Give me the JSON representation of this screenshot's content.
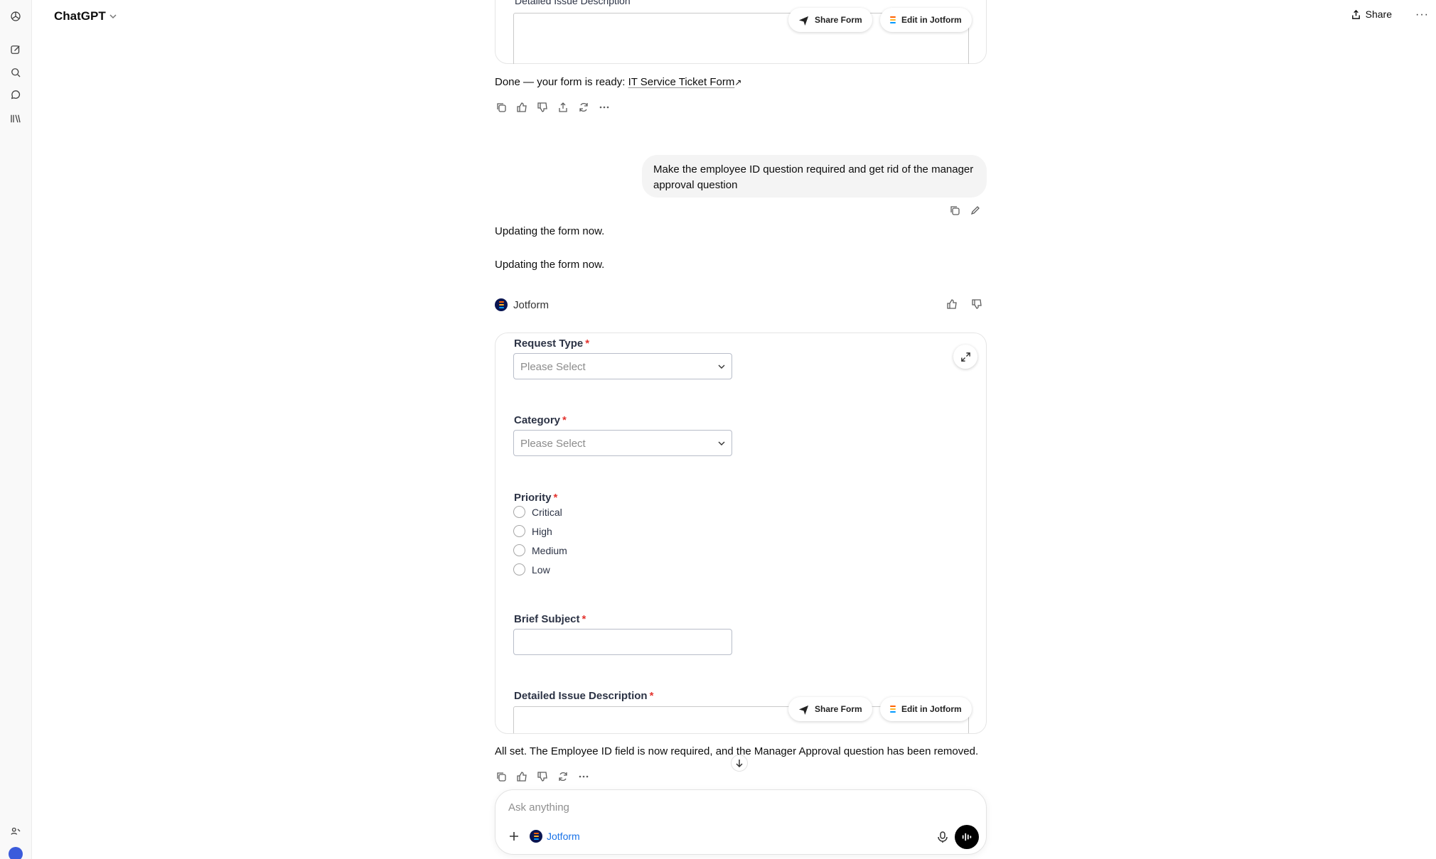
{
  "app": {
    "model_name": "ChatGPT"
  },
  "header": {
    "share_label": "Share",
    "more_label": "···"
  },
  "previous_form": {
    "partial_label": "Detailed Issue Description",
    "share_form_label": "Share Form",
    "edit_label": "Edit in Jotform"
  },
  "assistant_1": {
    "prefix": "Done — your form is ready: ",
    "link_text": "IT Service Ticket Form",
    "link_arrow": "↗"
  },
  "user_message": "Make the employee ID question required  and get rid of the manager approval question",
  "assistant_2": {
    "line1": "Updating the form now.",
    "line2": "Updating the form now."
  },
  "tool": {
    "name": "Jotform"
  },
  "form": {
    "fields": {
      "request_type": {
        "label": "Request Type",
        "placeholder": "Please Select"
      },
      "category": {
        "label": "Category",
        "placeholder": "Please Select"
      },
      "priority": {
        "label": "Priority",
        "options": [
          "Critical",
          "High",
          "Medium",
          "Low"
        ]
      },
      "brief_subject": {
        "label": "Brief Subject"
      },
      "description": {
        "label": "Detailed Issue Description"
      }
    },
    "required_marker": "*",
    "share_form_label": "Share Form",
    "edit_label": "Edit in Jotform"
  },
  "assistant_3": "All set. The Employee ID field is now required, and the Manager Approval question has been removed.",
  "composer": {
    "placeholder": "Ask anything",
    "tool_chip": "Jotform"
  },
  "colors": {
    "accent_link": "#1a73e8",
    "required": "#e3342f",
    "jotform_bars": [
      "#ff6100",
      "#ffb629",
      "#0099ff"
    ]
  }
}
